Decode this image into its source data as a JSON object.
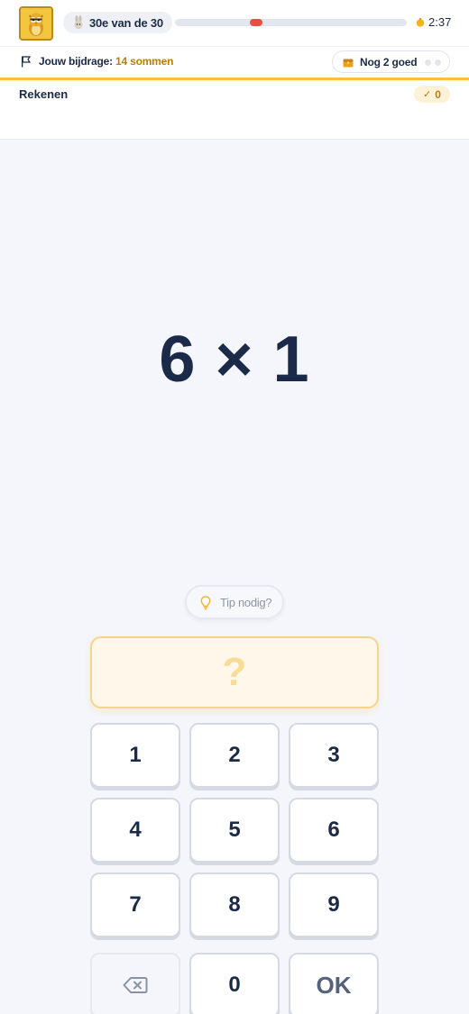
{
  "header": {
    "rank_text": "30e van de 30",
    "progress": 0.35,
    "timer": "2:37"
  },
  "contribution": {
    "label": "Jouw bijdrage:",
    "value": "14 sommen",
    "goal_text": "Nog 2 goed"
  },
  "subject": {
    "name": "Rekenen",
    "score": "0"
  },
  "question": {
    "text": "6 × 1"
  },
  "tip": {
    "label": "Tip nodig?"
  },
  "answer": {
    "placeholder": "?"
  },
  "keypad": {
    "keys": [
      "1",
      "2",
      "3",
      "4",
      "5",
      "6",
      "7",
      "8",
      "9",
      "",
      "0",
      "OK"
    ],
    "backspace_icon": "backspace-icon"
  },
  "colors": {
    "accent_yellow": "#f3c13a",
    "progress_marker": "#e0523f",
    "text_dark": "#1c2b45",
    "highlight_brown": "#b97d0c"
  }
}
